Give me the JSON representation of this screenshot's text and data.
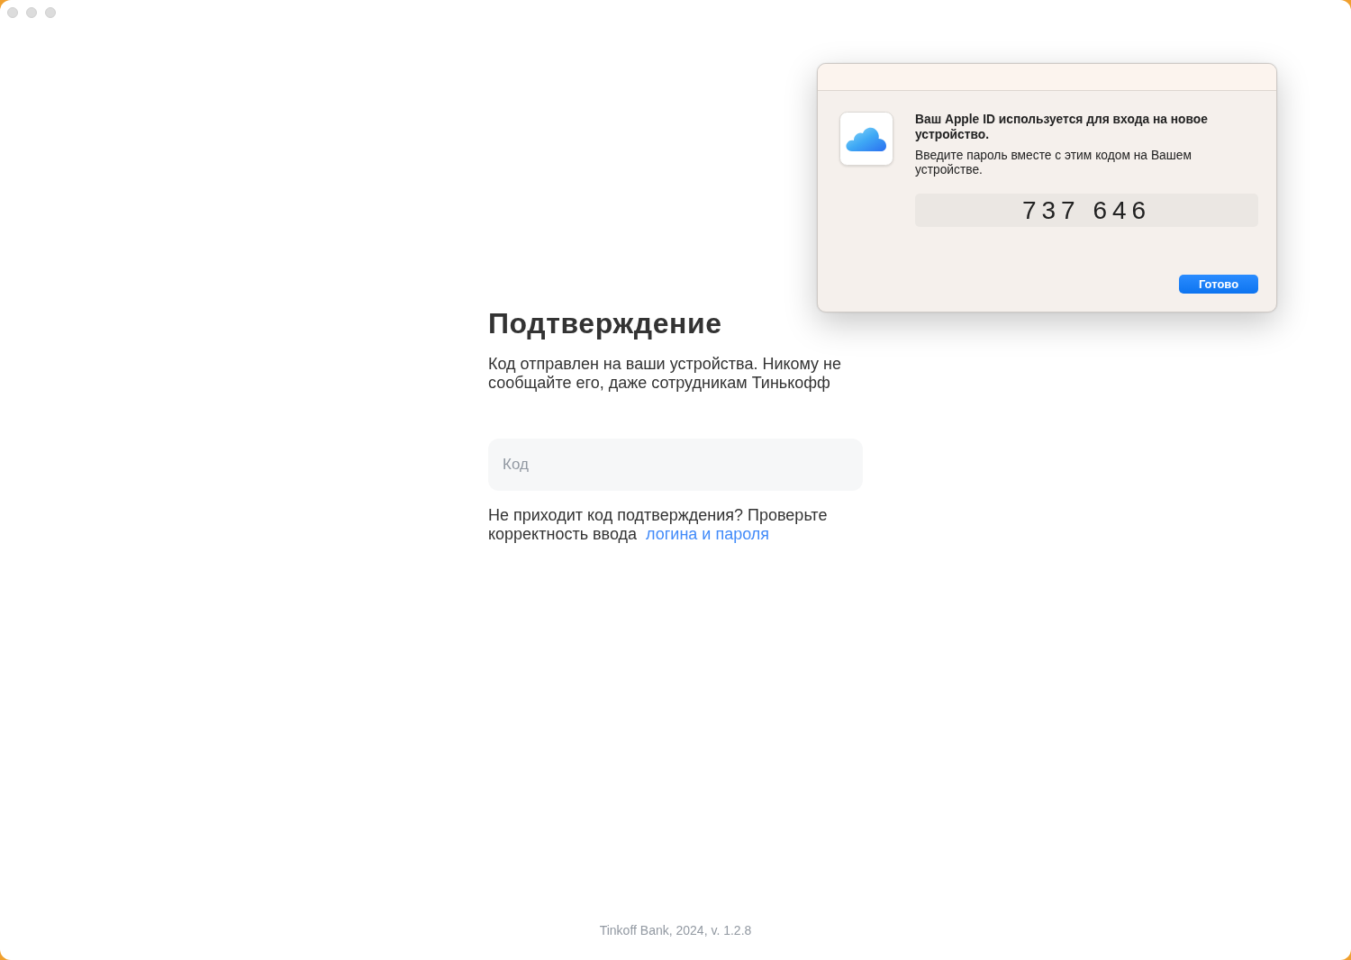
{
  "window": {
    "focused": false
  },
  "confirmation": {
    "title": "Подтверждение",
    "description": "Код отправлен на ваши устройства. Никому не сообщайте его, даже сотрудникам Тинькофф",
    "code_field": {
      "placeholder": "Код"
    },
    "help": {
      "text": "Не приходит код подтверждения? Проверьте корректность ввода",
      "link": "логина и пароля"
    }
  },
  "footer": "Tinkoff Bank, 2024, v. 1.2.8",
  "apple_id_alert": {
    "title": "Ваш Apple ID используется для входа на новое устройство.",
    "message": "Введите пароль вместе с этим кодом на Вашем устройстве.",
    "code": "737 646",
    "button": "Готово"
  }
}
